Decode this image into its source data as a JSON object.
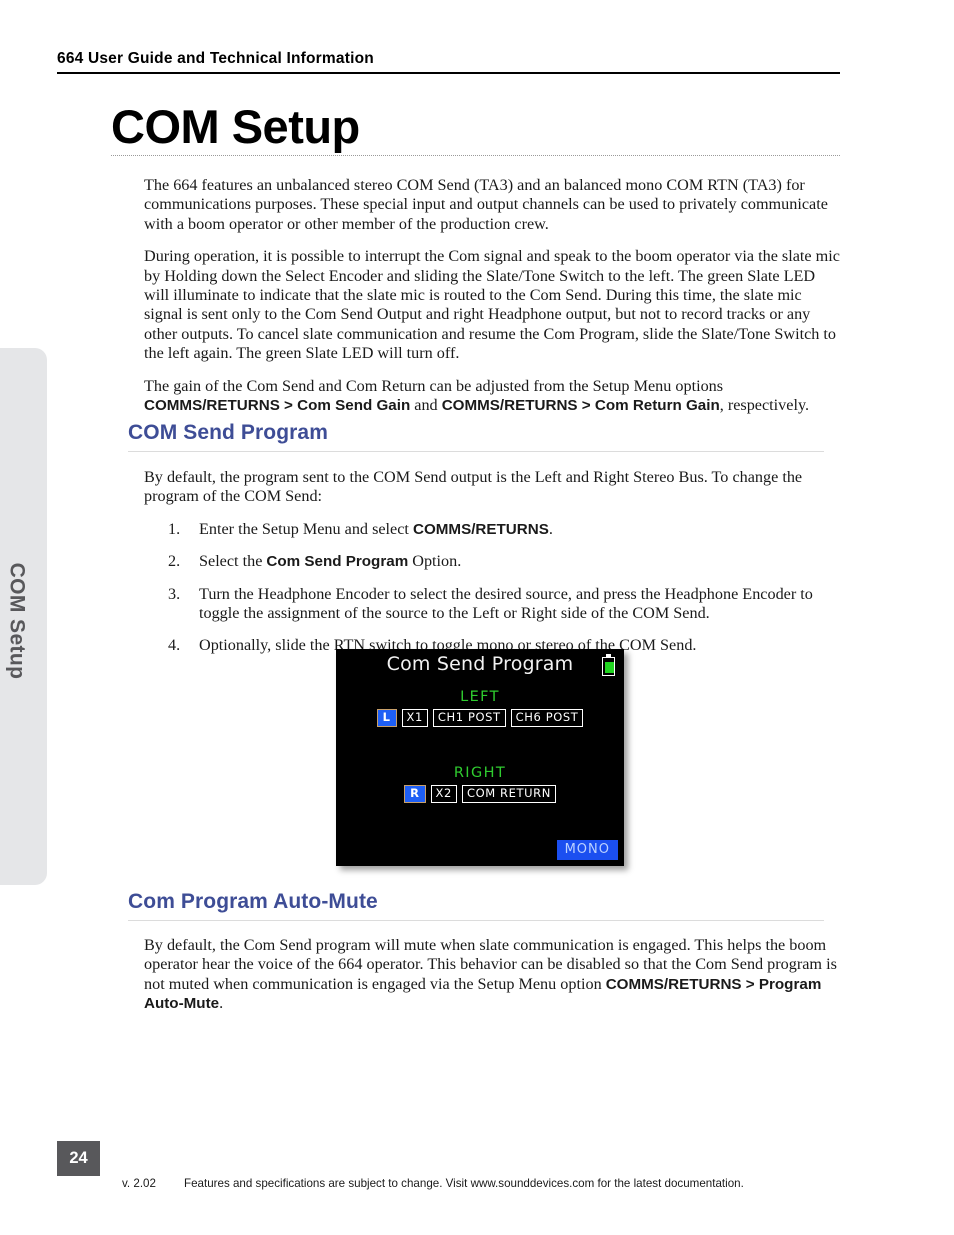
{
  "header": {
    "running_title": "664 User Guide and Technical Information"
  },
  "chapter": {
    "title": "COM Setup",
    "side_tab_label": "COM Setup"
  },
  "intro": {
    "paragraph_1_a": "The 664 features an unbalanced stereo COM Send (TA3) and an balanced mono COM RTN (TA3) for communications purposes. These special input and output channels can be used to privately communicate with a boom operator or other member of the production crew.",
    "paragraph_2": "During operation, it is possible to interrupt the Com signal and speak to the boom operator via the slate mic by Holding down the Select Encoder and sliding the Slate/Tone Switch to the left. The green Slate LED will illuminate to indicate that the slate mic is routed to the Com Send. During this time, the slate mic signal is sent only to the Com Send Output and right Headphone output, but not to record tracks or any other outputs. To cancel slate communication and resume the Com Program, slide the Slate/Tone Switch to the left again. The green Slate LED will turn off.",
    "paragraph_3_lead": "The gain of the Com Send and Com Return can be adjusted from the Setup Menu options ",
    "paragraph_3_bold_1": "COMMS/RETURNS > Com Send Gain",
    "paragraph_3_mid": " and ",
    "paragraph_3_bold_2": "COMMS/RETURNS > Com Return Gain",
    "paragraph_3_tail": ", respectively."
  },
  "section_com_send_program": {
    "heading": "COM Send Program",
    "intro": "By default, the program sent to the COM Send output is the Left and Right Stereo Bus. To change the program of the COM Send:",
    "steps": [
      {
        "num": "1.",
        "lead": "Enter the Setup Menu and select ",
        "bold": "COMMS/RETURNS",
        "tail": "."
      },
      {
        "num": "2.",
        "lead": "Select the ",
        "bold": "Com Send Program",
        "tail": " Option."
      },
      {
        "num": "3.",
        "lead": "Turn the Headphone Encoder to select the desired source, and press the Headphone Encoder to toggle the assignment of the source to the Left or Right side of the COM Send.",
        "bold": "",
        "tail": ""
      },
      {
        "num": "4.",
        "lead": "Optionally, slide the RTN switch to toggle mono or stereo of the COM Send.",
        "bold": "",
        "tail": ""
      }
    ]
  },
  "lcd_screen": {
    "title": "Com Send Program",
    "battery_icon": "battery-icon",
    "left_label": "LEFT",
    "left_chips": [
      "L",
      "X1",
      "CH1 POST",
      "CH6 POST"
    ],
    "right_label": "RIGHT",
    "right_chips": [
      "R",
      "X2",
      "COM RETURN"
    ],
    "mode_badge": "MONO",
    "colors": {
      "background": "#000000",
      "title_text": "#f2f2f2",
      "group_label": "#2fcc2f",
      "chip_border": "#ffffff",
      "side_chip_fill": "#1e5ff5",
      "side_chip_border": "#c8a06a",
      "mono_fill": "#1b4ff0",
      "mono_text": "#bcd2ff",
      "battery_fill": "#21d521"
    }
  },
  "section_auto_mute": {
    "heading": "Com Program Auto-Mute",
    "paragraph_lead": "By default, the Com Send program will mute when slate communication is engaged. This helps the boom operator hear the voice of the 664 operator. This behavior can be disabled so that the Com Send program is not muted when communication is engaged via the Setup Menu option ",
    "paragraph_bold": "COMMS/RETURNS > Program Auto-Mute",
    "paragraph_tail": "."
  },
  "footer": {
    "page_number": "24",
    "version": "v. 2.02",
    "notice": "Features and specifications are subject to change. Visit www.sounddevices.com for the latest documentation."
  },
  "theme": {
    "heading_blue": "#3e4d96",
    "tab_gray": "#e5e6e8",
    "page_badge_gray": "#58585b"
  }
}
